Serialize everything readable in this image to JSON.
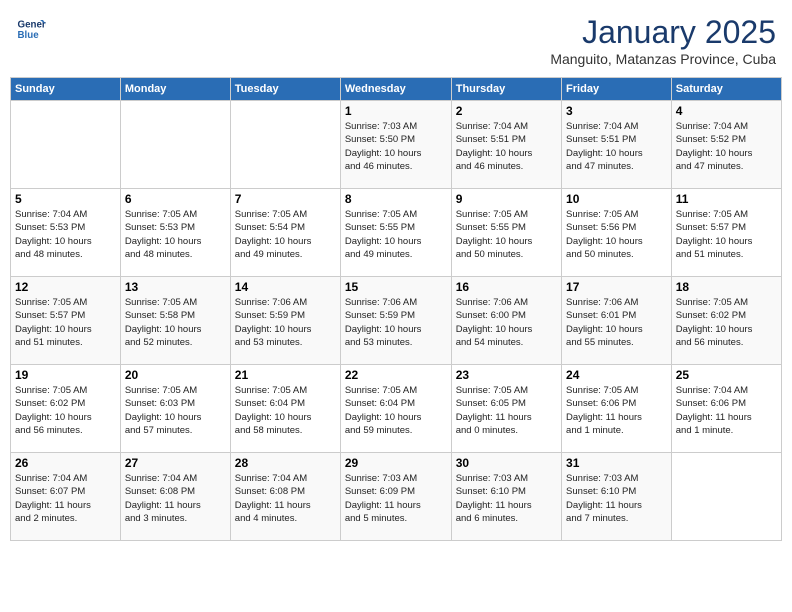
{
  "header": {
    "logo_line1": "General",
    "logo_line2": "Blue",
    "month": "January 2025",
    "location": "Manguito, Matanzas Province, Cuba"
  },
  "days_of_week": [
    "Sunday",
    "Monday",
    "Tuesday",
    "Wednesday",
    "Thursday",
    "Friday",
    "Saturday"
  ],
  "weeks": [
    [
      {
        "day": "",
        "info": ""
      },
      {
        "day": "",
        "info": ""
      },
      {
        "day": "",
        "info": ""
      },
      {
        "day": "1",
        "info": "Sunrise: 7:03 AM\nSunset: 5:50 PM\nDaylight: 10 hours\nand 46 minutes."
      },
      {
        "day": "2",
        "info": "Sunrise: 7:04 AM\nSunset: 5:51 PM\nDaylight: 10 hours\nand 46 minutes."
      },
      {
        "day": "3",
        "info": "Sunrise: 7:04 AM\nSunset: 5:51 PM\nDaylight: 10 hours\nand 47 minutes."
      },
      {
        "day": "4",
        "info": "Sunrise: 7:04 AM\nSunset: 5:52 PM\nDaylight: 10 hours\nand 47 minutes."
      }
    ],
    [
      {
        "day": "5",
        "info": "Sunrise: 7:04 AM\nSunset: 5:53 PM\nDaylight: 10 hours\nand 48 minutes."
      },
      {
        "day": "6",
        "info": "Sunrise: 7:05 AM\nSunset: 5:53 PM\nDaylight: 10 hours\nand 48 minutes."
      },
      {
        "day": "7",
        "info": "Sunrise: 7:05 AM\nSunset: 5:54 PM\nDaylight: 10 hours\nand 49 minutes."
      },
      {
        "day": "8",
        "info": "Sunrise: 7:05 AM\nSunset: 5:55 PM\nDaylight: 10 hours\nand 49 minutes."
      },
      {
        "day": "9",
        "info": "Sunrise: 7:05 AM\nSunset: 5:55 PM\nDaylight: 10 hours\nand 50 minutes."
      },
      {
        "day": "10",
        "info": "Sunrise: 7:05 AM\nSunset: 5:56 PM\nDaylight: 10 hours\nand 50 minutes."
      },
      {
        "day": "11",
        "info": "Sunrise: 7:05 AM\nSunset: 5:57 PM\nDaylight: 10 hours\nand 51 minutes."
      }
    ],
    [
      {
        "day": "12",
        "info": "Sunrise: 7:05 AM\nSunset: 5:57 PM\nDaylight: 10 hours\nand 51 minutes."
      },
      {
        "day": "13",
        "info": "Sunrise: 7:05 AM\nSunset: 5:58 PM\nDaylight: 10 hours\nand 52 minutes."
      },
      {
        "day": "14",
        "info": "Sunrise: 7:06 AM\nSunset: 5:59 PM\nDaylight: 10 hours\nand 53 minutes."
      },
      {
        "day": "15",
        "info": "Sunrise: 7:06 AM\nSunset: 5:59 PM\nDaylight: 10 hours\nand 53 minutes."
      },
      {
        "day": "16",
        "info": "Sunrise: 7:06 AM\nSunset: 6:00 PM\nDaylight: 10 hours\nand 54 minutes."
      },
      {
        "day": "17",
        "info": "Sunrise: 7:06 AM\nSunset: 6:01 PM\nDaylight: 10 hours\nand 55 minutes."
      },
      {
        "day": "18",
        "info": "Sunrise: 7:05 AM\nSunset: 6:02 PM\nDaylight: 10 hours\nand 56 minutes."
      }
    ],
    [
      {
        "day": "19",
        "info": "Sunrise: 7:05 AM\nSunset: 6:02 PM\nDaylight: 10 hours\nand 56 minutes."
      },
      {
        "day": "20",
        "info": "Sunrise: 7:05 AM\nSunset: 6:03 PM\nDaylight: 10 hours\nand 57 minutes."
      },
      {
        "day": "21",
        "info": "Sunrise: 7:05 AM\nSunset: 6:04 PM\nDaylight: 10 hours\nand 58 minutes."
      },
      {
        "day": "22",
        "info": "Sunrise: 7:05 AM\nSunset: 6:04 PM\nDaylight: 10 hours\nand 59 minutes."
      },
      {
        "day": "23",
        "info": "Sunrise: 7:05 AM\nSunset: 6:05 PM\nDaylight: 11 hours\nand 0 minutes."
      },
      {
        "day": "24",
        "info": "Sunrise: 7:05 AM\nSunset: 6:06 PM\nDaylight: 11 hours\nand 1 minute."
      },
      {
        "day": "25",
        "info": "Sunrise: 7:04 AM\nSunset: 6:06 PM\nDaylight: 11 hours\nand 1 minute."
      }
    ],
    [
      {
        "day": "26",
        "info": "Sunrise: 7:04 AM\nSunset: 6:07 PM\nDaylight: 11 hours\nand 2 minutes."
      },
      {
        "day": "27",
        "info": "Sunrise: 7:04 AM\nSunset: 6:08 PM\nDaylight: 11 hours\nand 3 minutes."
      },
      {
        "day": "28",
        "info": "Sunrise: 7:04 AM\nSunset: 6:08 PM\nDaylight: 11 hours\nand 4 minutes."
      },
      {
        "day": "29",
        "info": "Sunrise: 7:03 AM\nSunset: 6:09 PM\nDaylight: 11 hours\nand 5 minutes."
      },
      {
        "day": "30",
        "info": "Sunrise: 7:03 AM\nSunset: 6:10 PM\nDaylight: 11 hours\nand 6 minutes."
      },
      {
        "day": "31",
        "info": "Sunrise: 7:03 AM\nSunset: 6:10 PM\nDaylight: 11 hours\nand 7 minutes."
      },
      {
        "day": "",
        "info": ""
      }
    ]
  ]
}
